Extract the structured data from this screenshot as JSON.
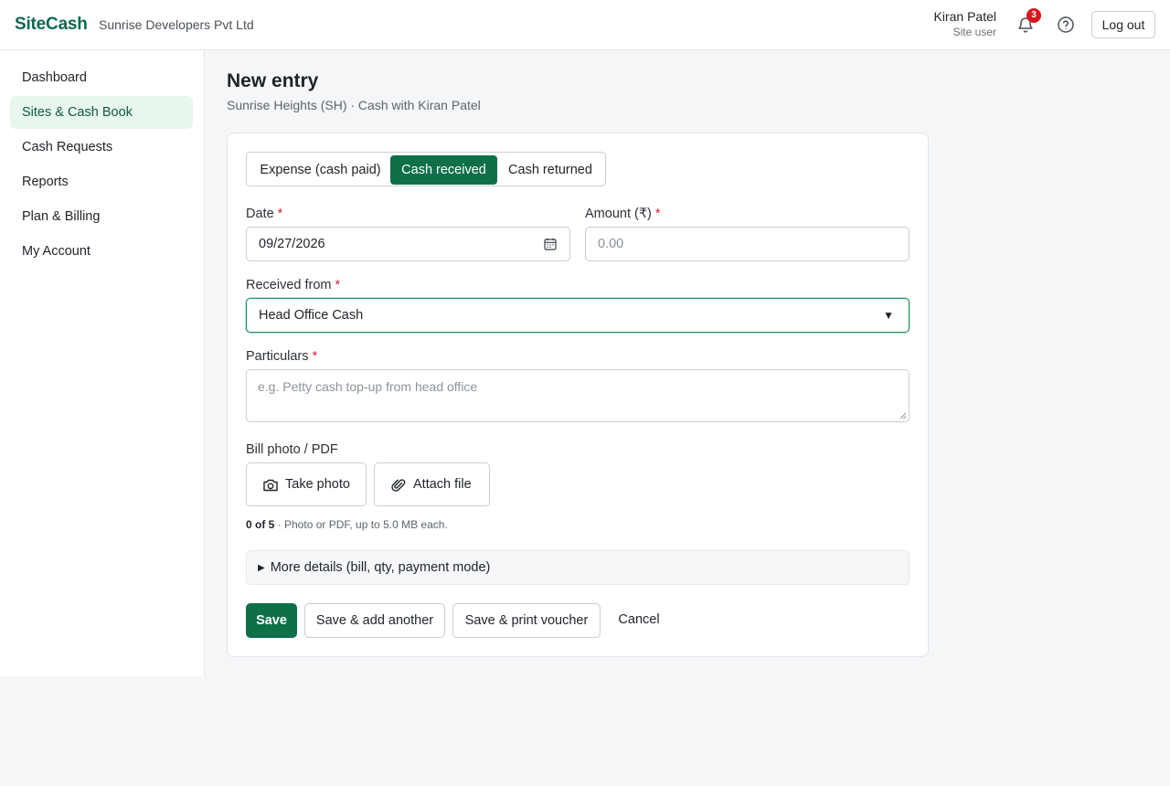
{
  "header": {
    "brand": "SiteCash",
    "company": "Sunrise Developers Pvt Ltd",
    "user_name": "Kiran Patel",
    "user_role": "Site user",
    "notification_count": "3",
    "logout_label": "Log out"
  },
  "sidebar": {
    "items": [
      {
        "label": "Dashboard"
      },
      {
        "label": "Sites & Cash Book"
      },
      {
        "label": "Cash Requests"
      },
      {
        "label": "Reports"
      },
      {
        "label": "Plan & Billing"
      },
      {
        "label": "My Account"
      }
    ],
    "active_index": 1
  },
  "page": {
    "title": "New entry",
    "subtitle": "Sunrise Heights (SH) · Cash with Kiran Patel"
  },
  "form": {
    "tabs": [
      {
        "label": "Expense (cash paid)"
      },
      {
        "label": "Cash received"
      },
      {
        "label": "Cash returned"
      }
    ],
    "active_tab": 1,
    "date": {
      "label": "Date",
      "required_mark": "*",
      "value": "09/27/2026"
    },
    "amount": {
      "label": "Amount (₹)",
      "required_mark": "*",
      "placeholder": "0.00"
    },
    "received_from": {
      "label": "Received from",
      "required_mark": "*",
      "value": "Head Office Cash"
    },
    "particulars": {
      "label": "Particulars",
      "required_mark": "*",
      "placeholder": "e.g. Petty cash top-up from head office"
    },
    "attachments": {
      "label": "Bill photo / PDF",
      "take_photo": "Take photo",
      "attach_file": "Attach file",
      "count": "0 of 5",
      "note": " · Photo or PDF, up to 5.0 MB each."
    },
    "more_details": "More details (bill, qty, payment mode)",
    "more_details_arrow": "▶",
    "actions": {
      "save": "Save",
      "save_add": "Save & add another",
      "save_print": "Save & print voucher",
      "cancel": "Cancel"
    }
  },
  "colors": {
    "brand": "#0f6b48",
    "primary": "#0f7048",
    "active_nav_bg": "#e8f6ee",
    "badge": "#d7191f",
    "required": "#d1242f"
  },
  "icons": [
    "bell-icon",
    "help-icon",
    "calendar-icon",
    "dropdown-caret-icon",
    "camera-icon",
    "paperclip-icon",
    "disclosure-triangle-icon"
  ]
}
